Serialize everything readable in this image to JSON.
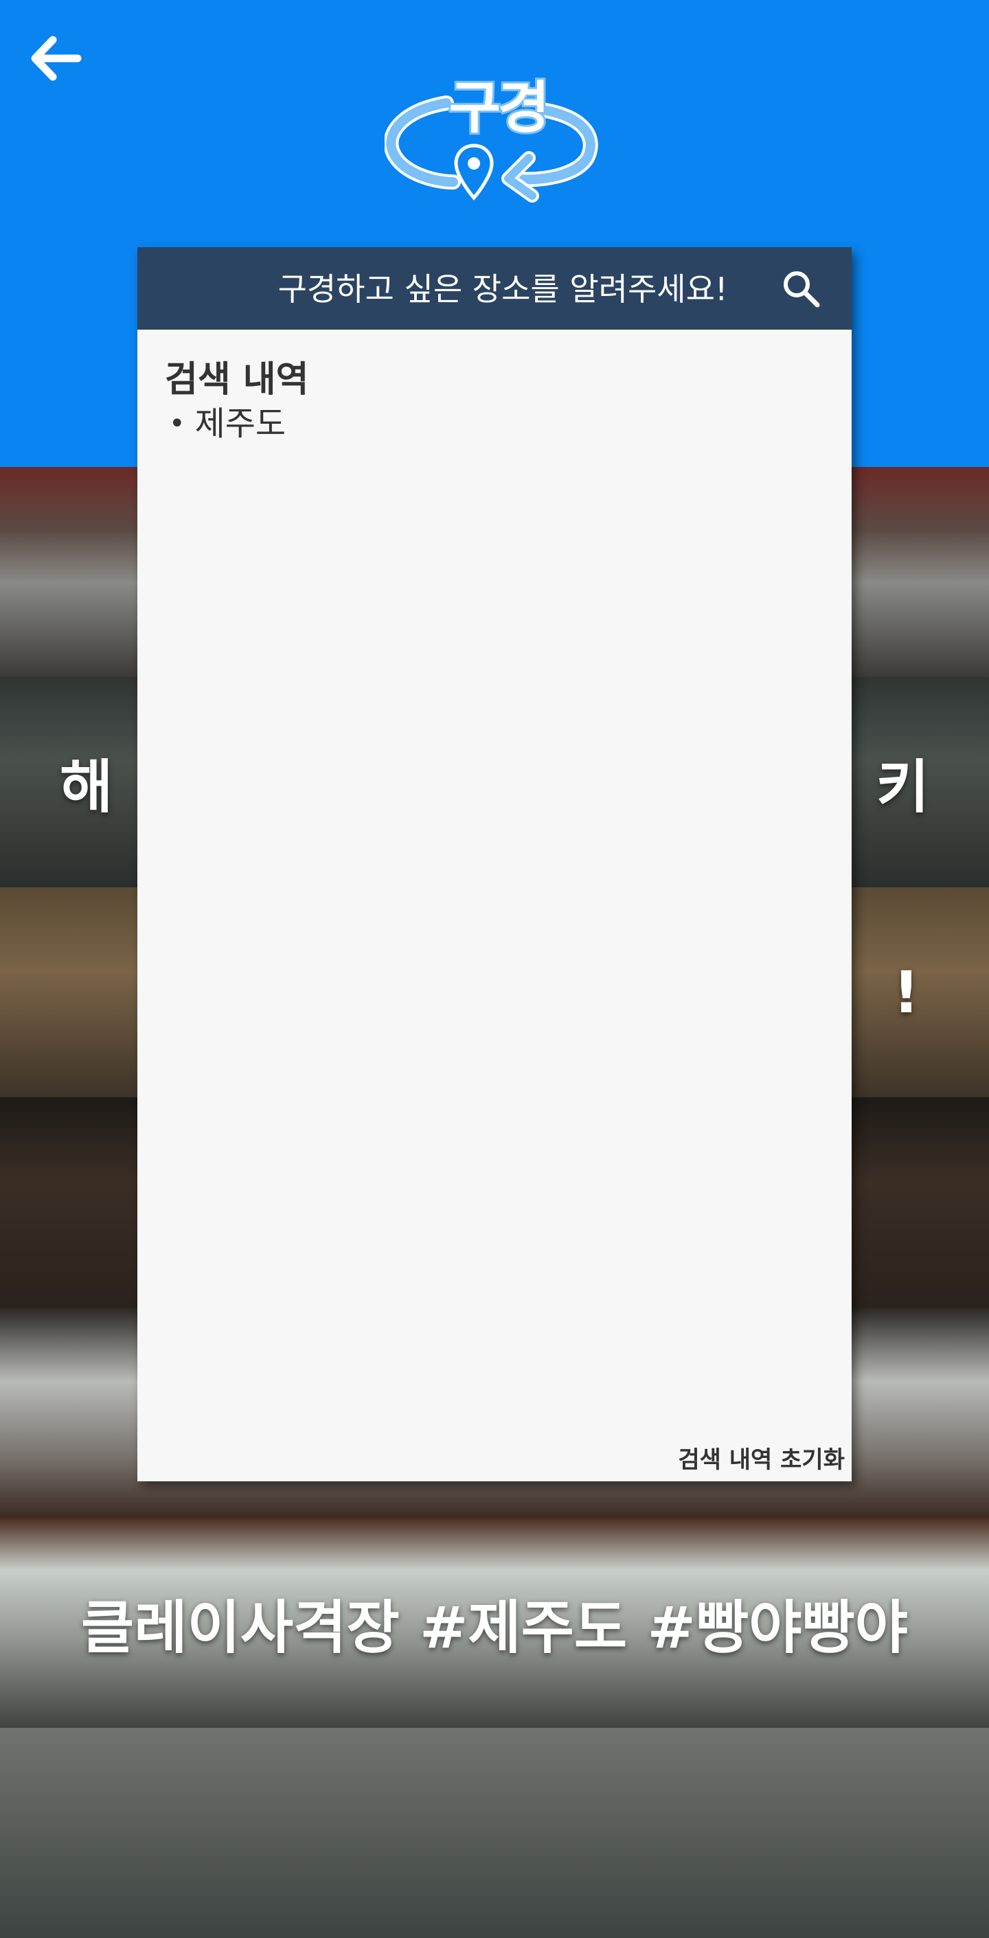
{
  "header": {
    "back_icon": "arrow-left-icon",
    "logo_text": "구경",
    "logo_icon": "map-pin-icon",
    "background_color": "#0a84f0"
  },
  "search": {
    "placeholder": "구경하고 싶은 장소를 알려주세요!",
    "value": "",
    "search_icon": "search-icon",
    "bar_color": "#2b4462"
  },
  "history": {
    "title": "검색 내역",
    "items": [
      {
        "bullet": "•",
        "label": "제주도"
      }
    ],
    "clear_label": "검색 내역 초기화"
  },
  "background_list": {
    "rows": [
      {
        "title": ""
      },
      {
        "title": "해                                      키"
      },
      {
        "title": "                                         !"
      },
      {
        "title": ""
      },
      {
        "title": ""
      },
      {
        "title": "클레이사격장 #제주도 #빵야빵야"
      },
      {
        "title": ""
      }
    ]
  }
}
